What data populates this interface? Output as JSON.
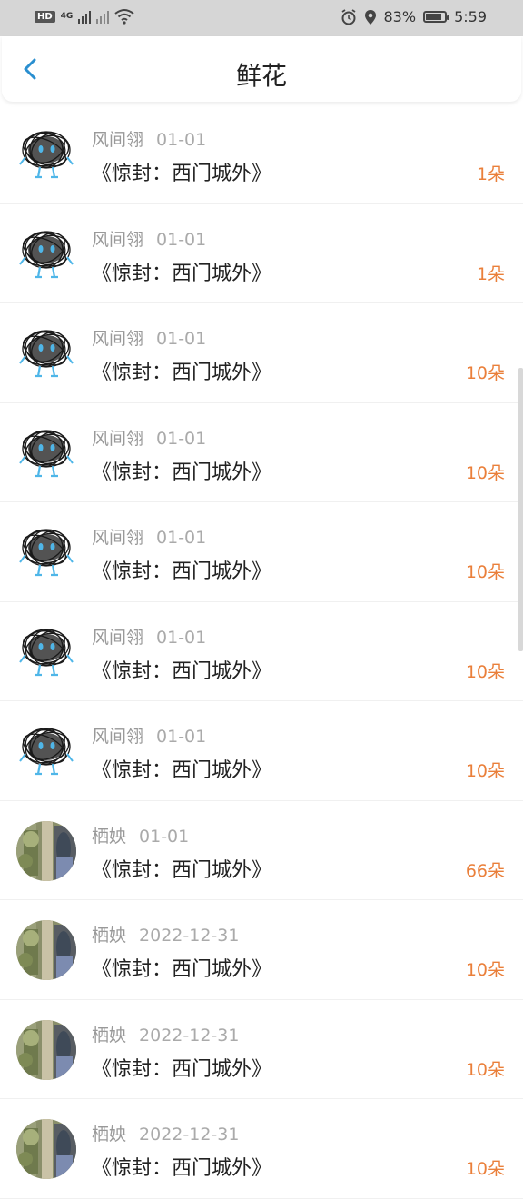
{
  "status_bar": {
    "hd": "HD",
    "net": "4G",
    "battery_percent": "83%",
    "battery_level": 0.83,
    "time": "5:59",
    "icons": [
      "hd-icon",
      "signal-icon",
      "wifi-icon",
      "alarm-icon",
      "location-icon",
      "battery-icon"
    ]
  },
  "header": {
    "title": "鲜花",
    "back_icon": "chevron-left-icon",
    "accent_color": "#2a8fd0"
  },
  "colors": {
    "amount": "#ea7f3a",
    "meta": "#999999",
    "text": "#222222"
  },
  "items": [
    {
      "avatar": "scribble",
      "name": "风间翎",
      "date": "01-01",
      "book": "《惊封：西门城外》",
      "amount": "1朵"
    },
    {
      "avatar": "scribble",
      "name": "风间翎",
      "date": "01-01",
      "book": "《惊封：西门城外》",
      "amount": "1朵"
    },
    {
      "avatar": "scribble",
      "name": "风间翎",
      "date": "01-01",
      "book": "《惊封：西门城外》",
      "amount": "10朵"
    },
    {
      "avatar": "scribble",
      "name": "风间翎",
      "date": "01-01",
      "book": "《惊封：西门城外》",
      "amount": "10朵"
    },
    {
      "avatar": "scribble",
      "name": "风间翎",
      "date": "01-01",
      "book": "《惊封：西门城外》",
      "amount": "10朵"
    },
    {
      "avatar": "scribble",
      "name": "风间翎",
      "date": "01-01",
      "book": "《惊封：西门城外》",
      "amount": "10朵"
    },
    {
      "avatar": "scribble",
      "name": "风间翎",
      "date": "01-01",
      "book": "《惊封：西门城外》",
      "amount": "10朵"
    },
    {
      "avatar": "photo",
      "name": "栖姎",
      "date": "01-01",
      "book": "《惊封：西门城外》",
      "amount": "66朵"
    },
    {
      "avatar": "photo",
      "name": "栖姎",
      "date": "2022-12-31",
      "book": "《惊封：西门城外》",
      "amount": "10朵"
    },
    {
      "avatar": "photo",
      "name": "栖姎",
      "date": "2022-12-31",
      "book": "《惊封：西门城外》",
      "amount": "10朵"
    },
    {
      "avatar": "photo",
      "name": "栖姎",
      "date": "2022-12-31",
      "book": "《惊封：西门城外》",
      "amount": "10朵"
    }
  ]
}
